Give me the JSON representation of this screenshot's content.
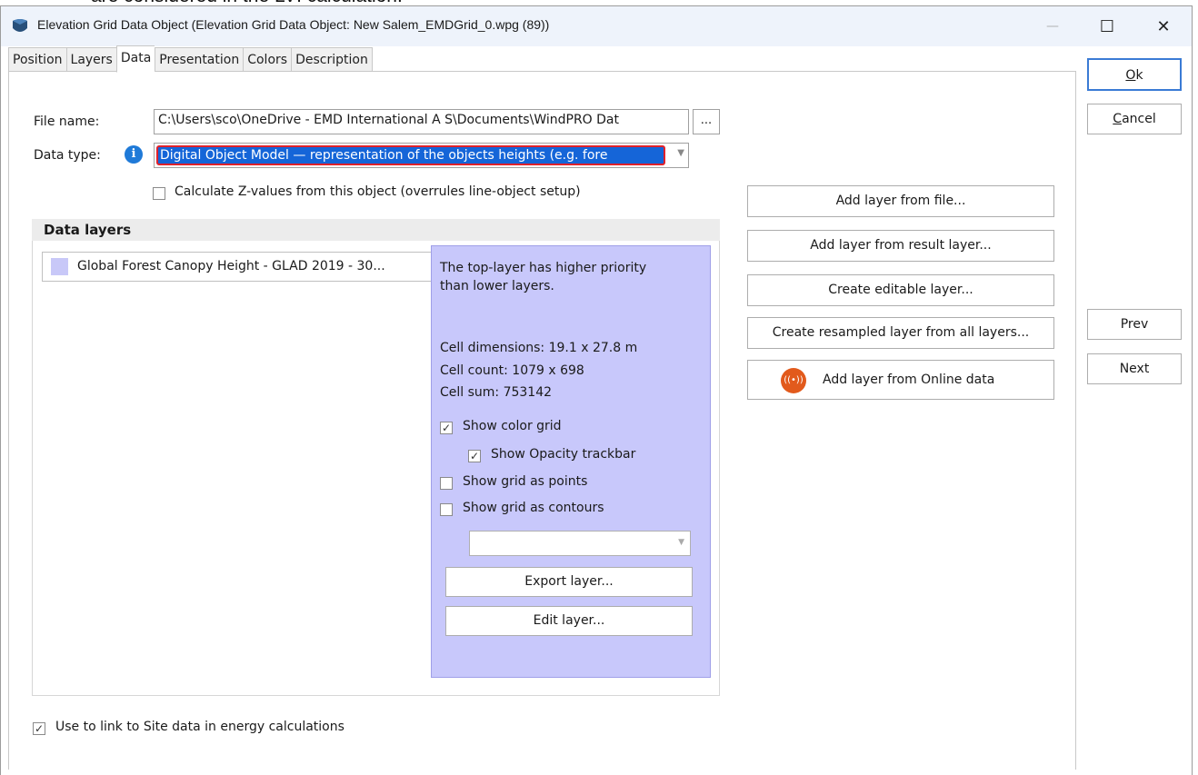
{
  "background_text": "are considered in the LVI calculation.",
  "window": {
    "title": "Elevation Grid Data Object  (Elevation Grid Data Object: New Salem_EMDGrid_0.wpg (89))",
    "minimize": "—",
    "maximize": "☐",
    "close": "✕"
  },
  "tabs": [
    "Position",
    "Layers",
    "Data",
    "Presentation",
    "Colors",
    "Description"
  ],
  "active_tab": "Data",
  "form": {
    "file_name_label": "File name:",
    "file_name_value": "C:\\Users\\sco\\OneDrive - EMD International A S\\Documents\\WindPRO Dat",
    "browse_label": "...",
    "data_type_label": "Data type:",
    "data_type_value": "Digital Object Model — representation of the objects heights (e.g. fore",
    "calc_z_label": "Calculate Z-values from this object (overrules line-object setup)",
    "calc_z_checked": false
  },
  "data_layers": {
    "heading": "Data layers",
    "items": [
      {
        "label": "Global Forest Canopy Height - GLAD 2019 - 30...",
        "color": "#c8c8f8"
      }
    ]
  },
  "layer_panel": {
    "info": [
      "The top-layer has higher priority",
      "than lower layers."
    ],
    "cell_dimensions": "Cell dimensions: 19.1 x 27.8 m",
    "cell_count": "Cell count: 1079 x 698",
    "cell_sum": "Cell sum: 753142",
    "show_color_grid": "Show color grid",
    "show_opacity": "Show Opacity trackbar",
    "show_points": "Show grid as points",
    "show_contours": "Show grid as contours",
    "export": "Export layer...",
    "edit": "Edit layer..."
  },
  "layer_actions": {
    "add_from_file": "Add layer from file...",
    "add_from_result": "Add layer from result layer...",
    "create_editable": "Create editable layer...",
    "create_resampled": "Create resampled layer from all layers...",
    "add_online": "Add layer from Online data"
  },
  "dialog_buttons": {
    "ok_prefix": "O",
    "ok_rest": "k",
    "cancel_prefix": "C",
    "cancel_rest": "ancel",
    "prev": "Prev",
    "next": "Next"
  },
  "footer": {
    "link_site_label": "Use to link to Site data in energy calculations",
    "link_site_checked": true
  },
  "colors": {
    "selection": "#1565d8",
    "highlight_border": "#e0212b",
    "panel": "#c8c8fb",
    "info_icon": "#1f7ad8"
  }
}
